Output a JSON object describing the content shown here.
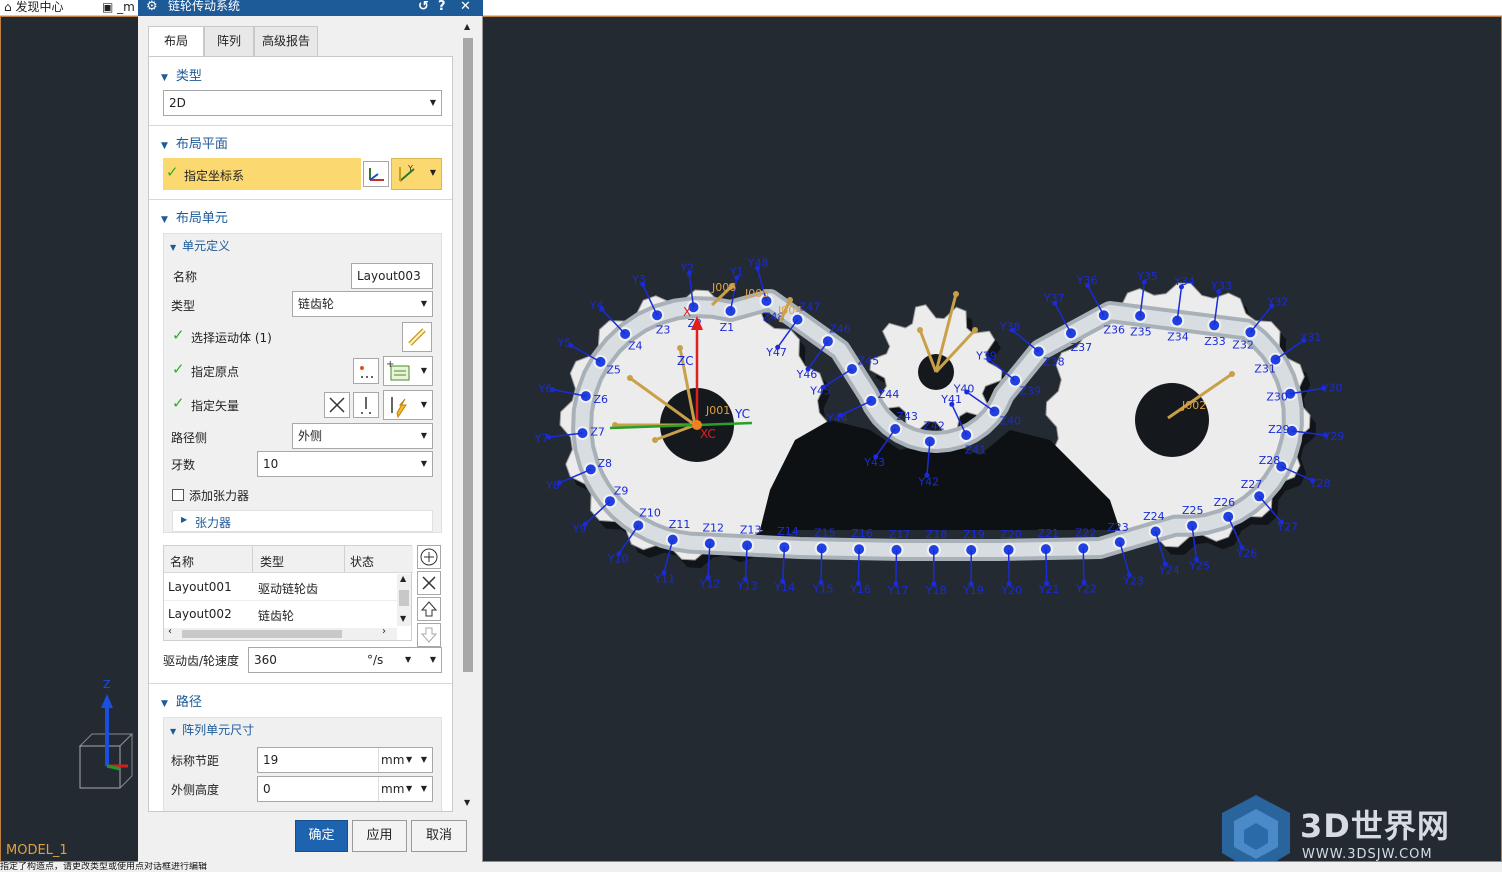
{
  "topbar": {
    "item1": "发现中心",
    "item2": "_m"
  },
  "dialog": {
    "title": "链轮传动系统",
    "tabs": [
      "布局",
      "阵列",
      "高级报告"
    ],
    "type_section": {
      "label": "类型",
      "value": "2D"
    },
    "plane_section": {
      "label": "布局平面",
      "specify_csys": "指定坐标系"
    },
    "unit_section": {
      "label": "布局单元",
      "unit_def": "单元定义",
      "name_label": "名称",
      "name_value": "Layout003",
      "type_label": "类型",
      "type_value": "链齿轮",
      "select_body": "选择运动体 (1)",
      "specify_origin": "指定原点",
      "specify_vector": "指定矢量",
      "path_side_label": "路径侧",
      "path_side_value": "外侧",
      "teeth_label": "牙数",
      "teeth_value": "10",
      "add_tensioner": "添加张力器",
      "tensioner": "张力器",
      "table": {
        "headers": [
          "名称",
          "类型",
          "状态"
        ],
        "rows": [
          [
            "Layout001",
            "驱动链轮齿",
            ""
          ],
          [
            "Layout002",
            "链齿轮",
            ""
          ]
        ]
      },
      "speed_label": "驱动齿/轮速度",
      "speed_value": "360",
      "speed_unit": "°/s"
    },
    "path_section": {
      "label": "路径",
      "array_size": "阵列单元尺寸",
      "pitch_label": "标称节距",
      "pitch_value": "19",
      "pitch_unit": "mm",
      "height_label": "外侧高度",
      "height_value": "0",
      "height_unit": "mm"
    },
    "buttons": {
      "ok": "确定",
      "apply": "应用",
      "cancel": "取消"
    }
  },
  "viewport": {
    "model_label": "MODEL_1",
    "csys": {
      "zc": "ZC",
      "yc": "YC",
      "xc": "XC",
      "x": "X"
    },
    "joints": [
      "J001",
      "J002",
      "J004",
      "J005",
      "J006"
    ],
    "z_labels": [
      "Z1",
      "Z2",
      "Z3",
      "Z4",
      "Z5",
      "Z6",
      "Z7",
      "Z8",
      "Z9",
      "Z10",
      "Z11",
      "Z12",
      "Z13",
      "Z14",
      "Z15",
      "Z16",
      "Z17",
      "Z18",
      "Z19",
      "Z20",
      "Z21",
      "Z22",
      "Z23",
      "Z24",
      "Z25",
      "Z26",
      "Z27",
      "Z28",
      "Z29",
      "Z30",
      "Z31",
      "Z32",
      "Z33",
      "Z34",
      "Z35",
      "Z36",
      "Z37",
      "Z38",
      "Z39",
      "Z40",
      "Z41",
      "Z42",
      "Z43",
      "Z44",
      "Z45",
      "Z46",
      "Z47",
      "Z48"
    ],
    "y_labels": [
      "Y1",
      "Y2",
      "Y3",
      "Y4",
      "Y5",
      "Y6",
      "Y7",
      "Y8",
      "Y9",
      "Y10",
      "Y11",
      "Y12",
      "Y13",
      "Y14",
      "Y15",
      "Y16",
      "Y17",
      "Y18",
      "Y19",
      "Y20",
      "Y21",
      "Y22",
      "Y23",
      "Y24",
      "Y25",
      "Y26",
      "Y27",
      "Y28",
      "Y29",
      "Y30",
      "Y31",
      "Y32",
      "Y33",
      "Y34",
      "Y35",
      "Y36",
      "Y37",
      "Y38",
      "Y39",
      "Y40",
      "Y41",
      "Y42",
      "Y43",
      "Y44",
      "Y45",
      "Y46",
      "Y47",
      "Y48"
    ],
    "triad_z": "Z",
    "watermark": {
      "title": "3D世界网",
      "url": "WWW.3DSJW.COM"
    }
  },
  "statusbar": {
    "text": "指定了构造点，请更改类型或使用点对话框进行编辑"
  },
  "colors": {
    "title_bar": "#1d5a98",
    "highlight": "#fcd870",
    "viewport_bg": "#232a32",
    "chain_label": "#1a2bd8"
  }
}
